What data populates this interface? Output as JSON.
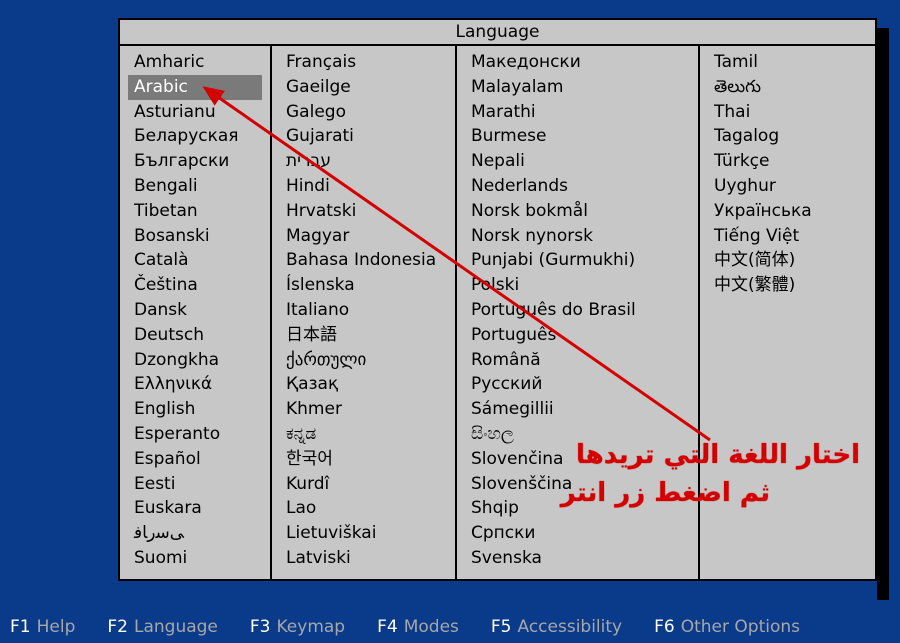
{
  "title": "Language",
  "selected": "Arabic",
  "columns": [
    [
      "Amharic",
      "Arabic",
      "Asturianu",
      "Беларуская",
      "Български",
      "Bengali",
      "Tibetan",
      "Bosanski",
      "Català",
      "Čeština",
      "Dansk",
      "Deutsch",
      "Dzongkha",
      "Ελληνικά",
      "English",
      "Esperanto",
      "Español",
      "Eesti",
      "Euskara",
      "ﻰﺳﺭﺎﻓ",
      "Suomi"
    ],
    [
      "Français",
      "Gaeilge",
      "Galego",
      "Gujarati",
      "עברית",
      "Hindi",
      "Hrvatski",
      "Magyar",
      "Bahasa Indonesia",
      "Íslenska",
      "Italiano",
      "日本語",
      "ქართული",
      "Қазақ",
      "Khmer",
      "ಕನ್ನಡ",
      "한국어",
      "Kurdî",
      "Lao",
      "Lietuviškai",
      "Latviski"
    ],
    [
      "Македонски",
      "Malayalam",
      "Marathi",
      "Burmese",
      "Nepali",
      "Nederlands",
      "Norsk bokmål",
      "Norsk nynorsk",
      "Punjabi (Gurmukhi)",
      "Polski",
      "Português do Brasil",
      "Português",
      "Română",
      "Русский",
      "Sámegillii",
      "සිංහල",
      "Slovenčina",
      "Slovenščina",
      "Shqip",
      "Српски",
      "Svenska"
    ],
    [
      "Tamil",
      "తెలుగు",
      "Thai",
      "Tagalog",
      "Türkçe",
      "Uyghur",
      "Українська",
      "Tiếng Việt",
      "中文(简体)",
      "中文(繁體)"
    ]
  ],
  "annotation": {
    "line1": "اختار اللغة التي تريدها",
    "line2": "ثم اضغط زر انتر"
  },
  "footer": [
    {
      "key": "F1",
      "label": "Help"
    },
    {
      "key": "F2",
      "label": "Language"
    },
    {
      "key": "F3",
      "label": "Keymap"
    },
    {
      "key": "F4",
      "label": "Modes"
    },
    {
      "key": "F5",
      "label": "Accessibility"
    },
    {
      "key": "F6",
      "label": "Other Options"
    }
  ]
}
